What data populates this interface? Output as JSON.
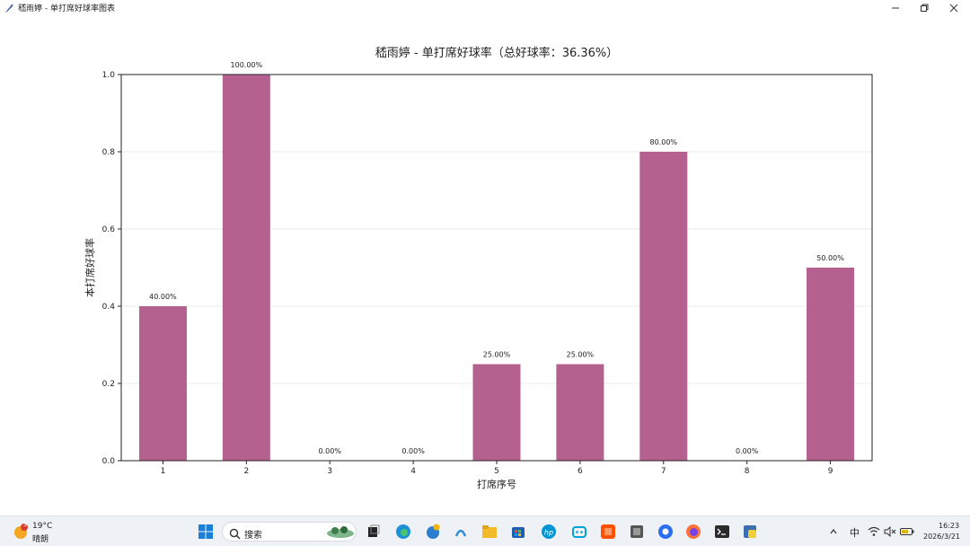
{
  "window": {
    "title": "嵇雨婷 - 单打席好球率图表",
    "controls": {
      "minimize": "—",
      "maximize": "⧉",
      "close": "✕"
    }
  },
  "chart_data": {
    "type": "bar",
    "title": "嵇雨婷 - 单打席好球率（总好球率：36.36%）",
    "xlabel": "打席序号",
    "ylabel": "本打席好球率",
    "categories": [
      "1",
      "2",
      "3",
      "4",
      "5",
      "6",
      "7",
      "8",
      "9"
    ],
    "values": [
      0.4,
      1.0,
      0.0,
      0.0,
      0.25,
      0.25,
      0.8,
      0.0,
      0.5
    ],
    "data_labels": [
      "40.00%",
      "100.00%",
      "0.00%",
      "0.00%",
      "25.00%",
      "25.00%",
      "80.00%",
      "0.00%",
      "50.00%"
    ],
    "yticks": [
      "0.0",
      "0.2",
      "0.4",
      "0.6",
      "0.8",
      "1.0"
    ],
    "ylim": [
      0,
      1.0
    ],
    "grid": "horizontal",
    "bar_color": "#b5618f"
  },
  "taskbar": {
    "weather": {
      "temp": "19°C",
      "condition": "晴朗",
      "badge": "3"
    },
    "search_placeholder": "搜索",
    "tray": {
      "ime": "中",
      "time": "16:23",
      "date": "2026/3/21"
    },
    "icons": [
      "start-icon",
      "search-icon",
      "task-view-icon",
      "edge-icon",
      "photos-icon",
      "copilot-icon",
      "file-explorer-icon",
      "store-icon",
      "hp-icon",
      "bilibili-icon",
      "taobao-icon",
      "app-icon",
      "browser-icon",
      "firefox-icon",
      "terminal-icon",
      "python-icon"
    ]
  }
}
